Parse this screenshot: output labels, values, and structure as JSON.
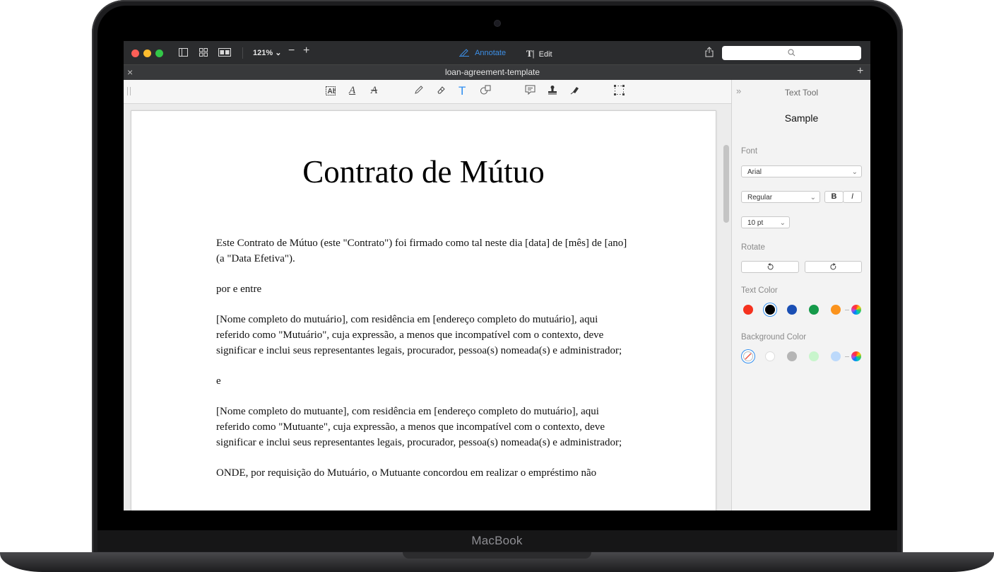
{
  "device": {
    "brand": "MacBook"
  },
  "toolbar": {
    "zoom": "121%",
    "annotate_label": "Annotate",
    "edit_label": "Edit",
    "search_placeholder": ""
  },
  "tab": {
    "title": "loan-agreement-template"
  },
  "document": {
    "title": "Contrato de Mútuo",
    "paragraphs": [
      "Este Contrato de Mútuo (este \"Contrato\") foi firmado como tal neste dia [data] de [mês] de [ano] (a \"Data Efetiva\").",
      "por e entre",
      "[Nome completo do mutuário], com residência em [endereço completo do mutuário], aqui referido como \"Mutuário\", cuja expressão, a menos que incompatível com o contexto, deve significar e inclui seus representantes legais, procurador, pessoa(s) nomeada(s) e administrador;",
      "e",
      "[Nome completo do mutuante], com residência em [endereço completo do mutuário], aqui referido como \"Mutuante\", cuja expressão, a menos que incompatível com o contexto, deve significar e inclui seus representantes legais, procurador, pessoa(s) nomeada(s) e administrador;",
      "ONDE, por requisição do Mutuário, o Mutuante concordou em realizar o empréstimo não"
    ]
  },
  "panel": {
    "title": "Text Tool",
    "sample": "Sample",
    "font_label": "Font",
    "font_value": "Arial",
    "style_value": "Regular",
    "bold_label": "B",
    "italic_label": "I",
    "size_value": "10 pt",
    "rotate_label": "Rotate",
    "text_color_label": "Text Color",
    "background_color_label": "Background Color",
    "text_colors": [
      "#f5321f",
      "#000000",
      "#1a4fb4",
      "#159a4a",
      "#fb931d"
    ],
    "background_colors": [
      "none",
      "#ffffff",
      "#b5b5b5",
      "#c8f5cc",
      "#bcd9fb"
    ]
  }
}
